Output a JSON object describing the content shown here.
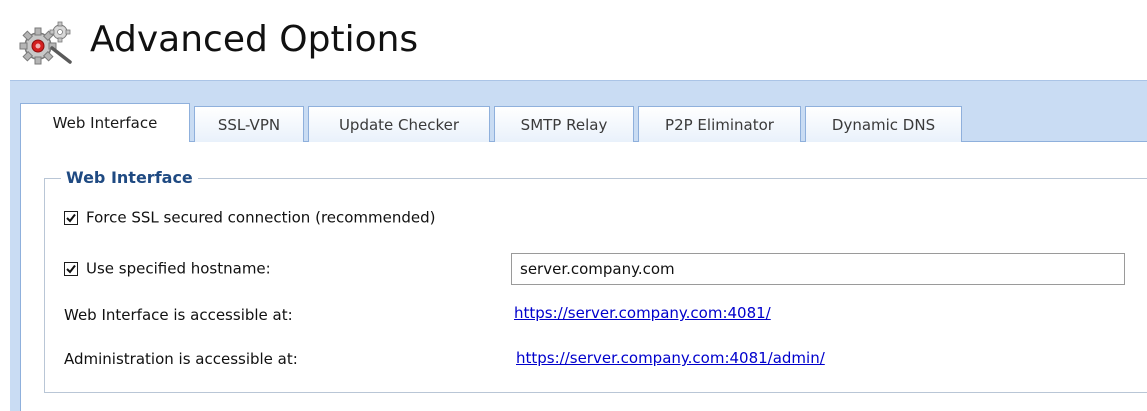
{
  "header": {
    "title": "Advanced Options",
    "icon": "gears-icon"
  },
  "tabs": [
    {
      "label": "Web Interface",
      "active": true
    },
    {
      "label": "SSL-VPN",
      "active": false
    },
    {
      "label": "Update Checker",
      "active": false
    },
    {
      "label": "SMTP Relay",
      "active": false
    },
    {
      "label": "P2P Eliminator",
      "active": false
    },
    {
      "label": "Dynamic DNS",
      "active": false
    }
  ],
  "group": {
    "legend": "Web Interface",
    "force_ssl": {
      "label": "Force SSL secured connection (recommended)",
      "checked": true
    },
    "hostname": {
      "label": "Use specified hostname:",
      "checked": true,
      "value": "server.company.com"
    },
    "web_access": {
      "label": "Web Interface is accessible at:",
      "url": "https://server.company.com:4081/"
    },
    "admin_access": {
      "label": "Administration is accessible at:",
      "url": "https://server.company.com:4081/admin/"
    }
  },
  "colors": {
    "frame": "#c9dcf3",
    "legend": "#1f4a82",
    "link": "#0000cc"
  }
}
